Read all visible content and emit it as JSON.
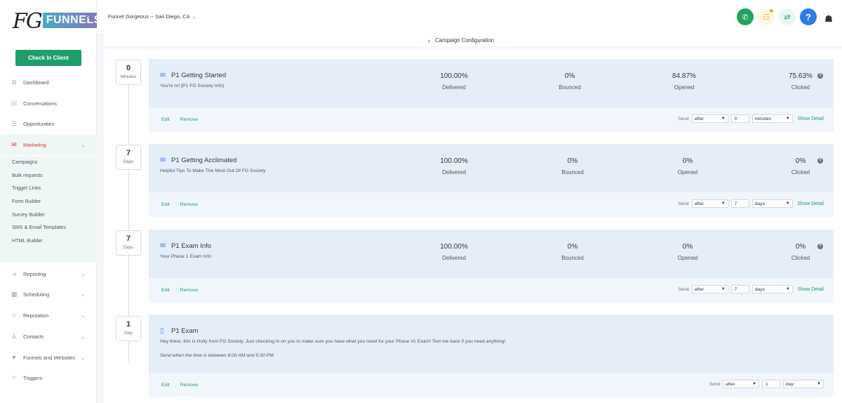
{
  "brand": {
    "fg": "FG",
    "name": "FUNNELS"
  },
  "sidebar": {
    "check_in": "Check In Client",
    "items": [
      {
        "label": "Dashboard",
        "icon": "dashboard-icon"
      },
      {
        "label": "Conversations",
        "icon": "chat-icon"
      },
      {
        "label": "Opportunities",
        "icon": "layers-icon"
      },
      {
        "label": "Marketing",
        "icon": "mail-icon"
      },
      {
        "label": "Reporting",
        "icon": "chart-icon"
      },
      {
        "label": "Scheduling",
        "icon": "calendar-icon"
      },
      {
        "label": "Reputation",
        "icon": "star-icon"
      },
      {
        "label": "Contacts",
        "icon": "person-icon"
      },
      {
        "label": "Funnels and Websites",
        "icon": "filter-icon"
      },
      {
        "label": "Triggers",
        "icon": "branch-icon"
      }
    ],
    "marketing_sub": [
      "Campaigns",
      "Bulk requests",
      "Trigger Links",
      "Form Builder",
      "Survey Builder",
      "SMS & Email Templates",
      "HTML Builder"
    ]
  },
  "header": {
    "location": "Funnel Gorgeous -- San Diego, CA"
  },
  "main": {
    "config_tab": "Campaign Configuration",
    "steps": [
      {
        "delay_num": "0",
        "delay_unit": "Minutes",
        "title": "P1 Getting Started",
        "subtitle": "You're In! [P1 FG Society Info]",
        "delivered": "100.00%",
        "bounced": "0%",
        "opened": "84.87%",
        "clicked": "75.63%",
        "send_label": "Send",
        "send_when": "after",
        "send_num": "0",
        "send_unit": "minutes"
      },
      {
        "delay_num": "7",
        "delay_unit": "Days",
        "title": "P1 Getting Acclimated",
        "subtitle": "Helpful Tips To Make The Most Out Of FG Society",
        "delivered": "100.00%",
        "bounced": "0%",
        "opened": "0%",
        "clicked": "0%",
        "send_label": "Send",
        "send_when": "after",
        "send_num": "7",
        "send_unit": "days"
      },
      {
        "delay_num": "7",
        "delay_unit": "Days",
        "title": "P1 Exam Info",
        "subtitle": "Your Phase 1 Exam Info",
        "delivered": "100.00%",
        "bounced": "0%",
        "opened": "0%",
        "clicked": "0%",
        "send_label": "Send",
        "send_when": "after",
        "send_num": "7",
        "send_unit": "days"
      }
    ],
    "sms_step": {
      "delay_num": "1",
      "delay_unit": "Day",
      "title": "P1 Exam",
      "body": "Hey there, this is Holly from FG Society. Just checking in on you to make sure you have what you need for your Phase #1 Exam! Text me back if you need anything!",
      "note": "Send when the time is between 8:00 AM and 5:00 PM",
      "send_label": "Send",
      "send_when": "after",
      "send_num": "1",
      "send_unit": "day"
    },
    "labels": {
      "delivered": "Delivered",
      "bounced": "Bounced",
      "opened": "Opened",
      "clicked": "Clicked",
      "edit": "Edit",
      "remove": "Remove",
      "show_detail": "Show Detail"
    }
  }
}
